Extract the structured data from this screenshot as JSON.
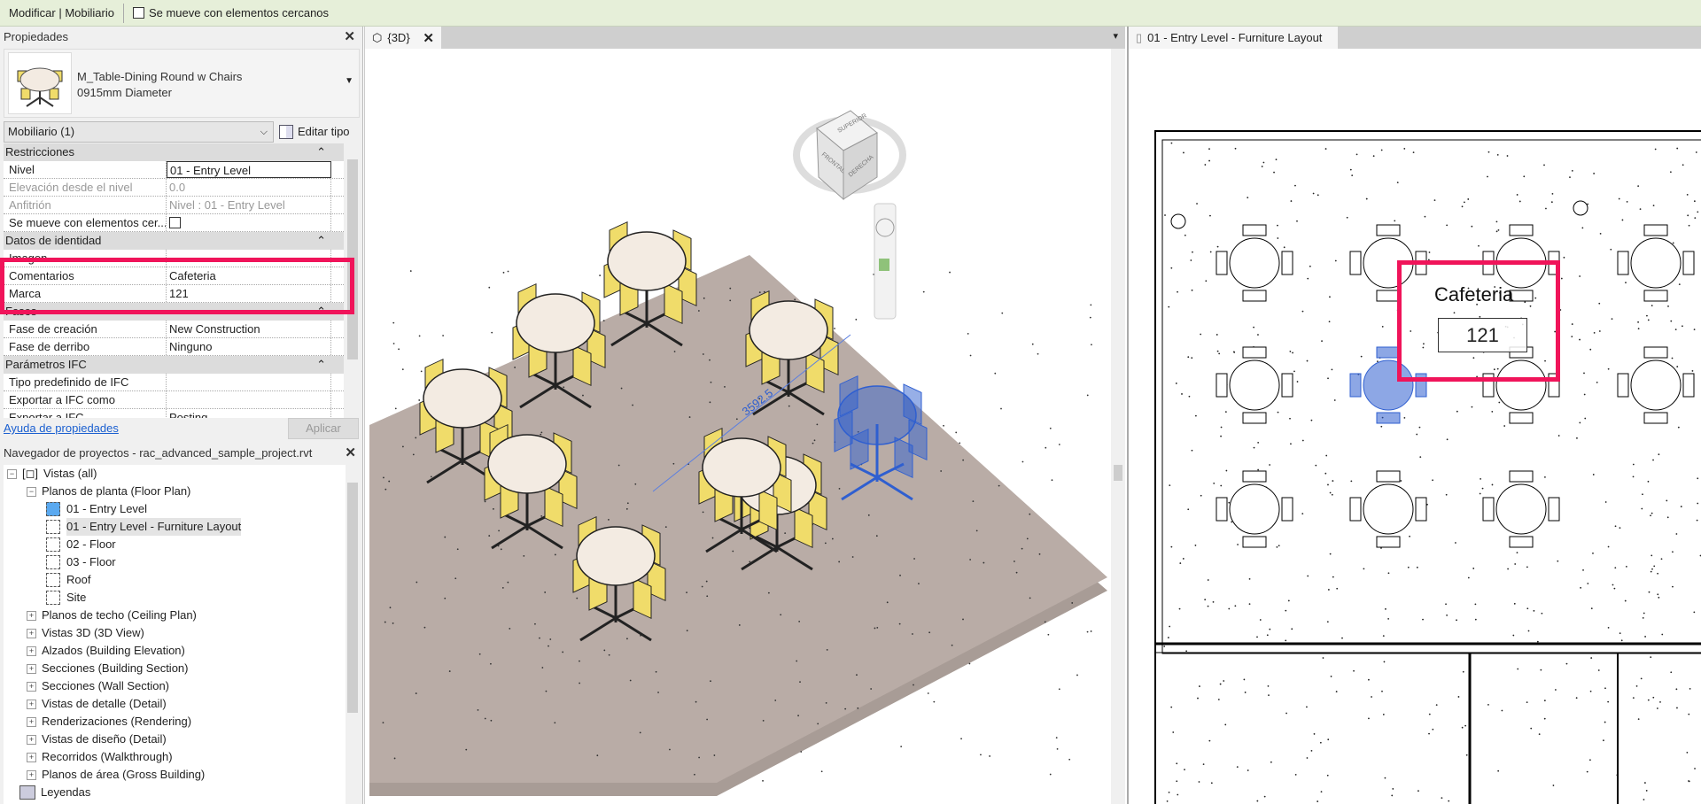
{
  "topbar": {
    "context": "Modificar | Mobiliario",
    "option": "Se mueve con elementos cercanos"
  },
  "properties": {
    "title": "Propiedades",
    "type_name": "M_Table-Dining Round w Chairs",
    "type_size": "0915mm Diameter",
    "category": "Mobiliario (1)",
    "edit_type": "Editar tipo",
    "rows": [
      {
        "kind": "group",
        "label": "Restricciones"
      },
      {
        "label": "Nivel",
        "value": "01 - Entry Level",
        "editing": true
      },
      {
        "label": "Elevación desde el nivel",
        "value": "0.0",
        "disabled": true
      },
      {
        "label": "Anfitrión",
        "value": "Nivel : 01 - Entry Level",
        "disabled": true
      },
      {
        "label": "Se mueve con elementos cer...",
        "checkbox": true
      },
      {
        "kind": "group",
        "label": "Datos de identidad"
      },
      {
        "label": "Imagen",
        "value": ""
      },
      {
        "label": "Comentarios",
        "value": "Cafeteria"
      },
      {
        "label": "Marca",
        "value": "121"
      },
      {
        "kind": "group",
        "label": "Fases"
      },
      {
        "label": "Fase de creación",
        "value": "New Construction"
      },
      {
        "label": "Fase de derribo",
        "value": "Ninguno"
      },
      {
        "kind": "group",
        "label": "Parámetros IFC"
      },
      {
        "label": "Tipo predefinido de IFC",
        "value": ""
      },
      {
        "label": "Exportar a IFC como",
        "value": ""
      },
      {
        "label": "Exportar a IFC",
        "value": "Posting"
      }
    ],
    "help": "Ayuda de propiedades",
    "apply": "Aplicar"
  },
  "navigator": {
    "title": "Navegador de proyectos - rac_advanced_sample_project.rvt",
    "items": [
      {
        "label": "Vistas (all)",
        "level": 0,
        "toggle": "−"
      },
      {
        "label": "Planos de planta (Floor Plan)",
        "level": 1,
        "toggle": "−"
      },
      {
        "label": "01 - Entry Level",
        "level": 2,
        "active": true
      },
      {
        "label": "01 - Entry Level - Furniture Layout",
        "level": 2,
        "selected": true
      },
      {
        "label": "02 - Floor",
        "level": 2
      },
      {
        "label": "03 - Floor",
        "level": 2
      },
      {
        "label": "Roof",
        "level": 2
      },
      {
        "label": "Site",
        "level": 2
      },
      {
        "label": "Planos de techo (Ceiling Plan)",
        "level": 1,
        "toggle": "+"
      },
      {
        "label": "Vistas 3D (3D View)",
        "level": 1,
        "toggle": "+"
      },
      {
        "label": "Alzados (Building Elevation)",
        "level": 1,
        "toggle": "+"
      },
      {
        "label": "Secciones (Building Section)",
        "level": 1,
        "toggle": "+"
      },
      {
        "label": "Secciones (Wall Section)",
        "level": 1,
        "toggle": "+"
      },
      {
        "label": "Vistas de detalle (Detail)",
        "level": 1,
        "toggle": "+"
      },
      {
        "label": "Renderizaciones (Rendering)",
        "level": 1,
        "toggle": "+"
      },
      {
        "label": "Vistas de diseño (Detail)",
        "level": 1,
        "toggle": "+"
      },
      {
        "label": "Recorridos (Walkthrough)",
        "level": 1,
        "toggle": "+"
      },
      {
        "label": "Planos de área (Gross Building)",
        "level": 1,
        "toggle": "+"
      },
      {
        "label": "Leyendas",
        "level": 0
      }
    ]
  },
  "view3d": {
    "tab": "{3D}",
    "dimension": "3592.5",
    "viewcube": {
      "top": "SUPERIOR",
      "front": "FRONTAL",
      "right": "DERECHA"
    }
  },
  "plan": {
    "tab": "01 - Entry Level - Furniture Layout",
    "comment_tag": "Cafeteria",
    "mark_tag": "121"
  },
  "colors": {
    "highlight": "#f0145a",
    "selection": "#2f5fd0",
    "chair": "#f0dc6a",
    "floor": "#b9aca6"
  }
}
